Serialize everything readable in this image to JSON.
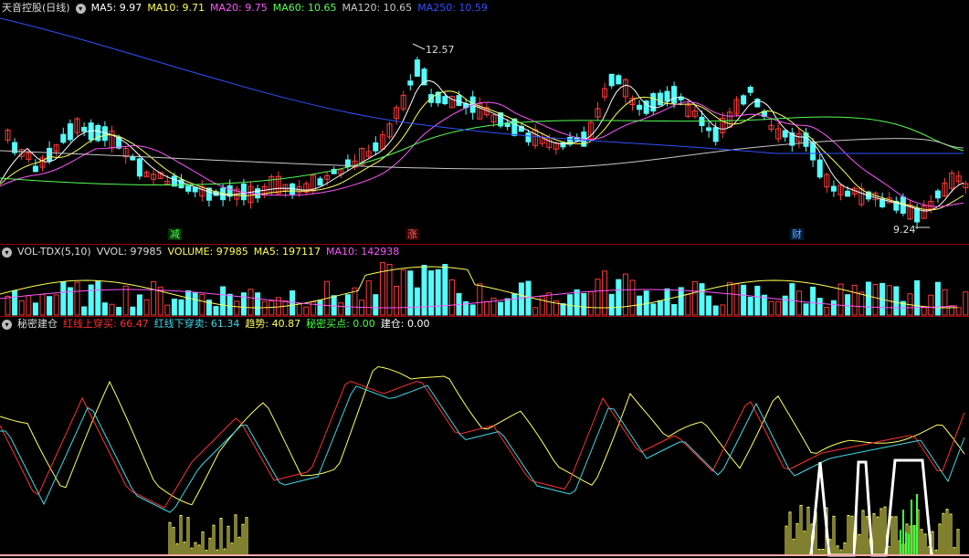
{
  "colors": {
    "up": "#ff3b3b",
    "down": "#54fcfc",
    "ma5": "#ffffff",
    "ma10": "#ffff55",
    "ma20": "#ff55ff",
    "ma60": "#55ff55",
    "ma120": "#c8c8c8",
    "ma250": "#3050ff",
    "red_line": "#ff3030",
    "cyan_line": "#40d8e8",
    "trend": "#ffff60",
    "secret_buy": "#40ff40",
    "build": "#ffffff",
    "separator": "#a00000"
  },
  "main": {
    "title": "天音控股(日线)",
    "ma_labels": [
      {
        "key": "ma5",
        "text": "MA5: 9.97"
      },
      {
        "key": "ma10",
        "text": "MA10: 9.71"
      },
      {
        "key": "ma20",
        "text": "MA20: 9.75"
      },
      {
        "key": "ma60",
        "text": "MA60: 10.65"
      },
      {
        "key": "ma120",
        "text": "MA120: 10.65"
      },
      {
        "key": "ma250",
        "text": "MA250: 10.59"
      }
    ],
    "high_label": "12.57",
    "low_label": "9.24",
    "markers": [
      {
        "text": "减",
        "color": "#55ff55",
        "bg": "#004400"
      },
      {
        "text": "涨",
        "color": "#ff5555",
        "bg": "#440000"
      },
      {
        "text": "财",
        "color": "#55aaff",
        "bg": "#002244"
      }
    ]
  },
  "volume": {
    "title": "VOL-TDX(5,10)",
    "labels": [
      {
        "key": "vol",
        "text": "VVOL: 97985"
      },
      {
        "key": "volume",
        "text": "VOLUME: 97985"
      },
      {
        "key": "ma5",
        "text": "MA5: 197117"
      },
      {
        "key": "ma10",
        "text": "MA10: 142938"
      }
    ]
  },
  "indicator": {
    "title": "秘密建仓",
    "labels": [
      {
        "key": "red_line",
        "text": "红线上穿买: 66.47"
      },
      {
        "key": "cyan_line",
        "text": "红线下穿卖: 61.34"
      },
      {
        "key": "trend",
        "text": "趋势: 40.87"
      },
      {
        "key": "secret_buy",
        "text": "秘密买点: 0.00"
      },
      {
        "key": "build",
        "text": "建仓: 0.00"
      }
    ]
  }
}
